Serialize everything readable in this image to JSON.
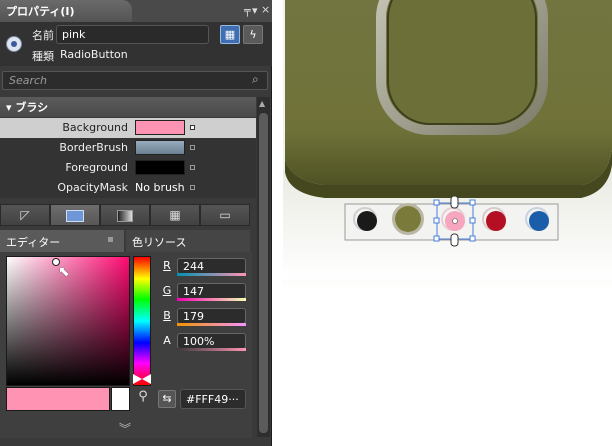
{
  "panel": {
    "title": "プロパティ(I)",
    "header_icons": [
      "pin-icon",
      "dropdown-icon",
      "close-icon"
    ],
    "name_label": "名前",
    "name_value": "pink",
    "type_label": "種類",
    "type_value": "RadioButton",
    "search_placeholder": "Search",
    "category": "ブラシ"
  },
  "brush_properties": [
    {
      "label": "Background",
      "color": "#ff93b3"
    },
    {
      "label": "BorderBrush",
      "color": "#7f96a8"
    },
    {
      "label": "Foreground",
      "color": "#000000"
    },
    {
      "label": "OpacityMask",
      "value": "No brush"
    }
  ],
  "brush_tools": [
    "no-brush-icon",
    "solid-brush-icon",
    "gradient-brush-icon",
    "tile-brush-icon",
    "resource-brush-icon"
  ],
  "color_tabs": {
    "editor": "エディター",
    "resources": "色リソース"
  },
  "color": {
    "channels": [
      {
        "label": "R",
        "value": "244"
      },
      {
        "label": "G",
        "value": "147"
      },
      {
        "label": "B",
        "value": "179"
      },
      {
        "label": "A",
        "value": "100%"
      }
    ],
    "hex": "#FFF49···",
    "current": "#ff93b3",
    "previous": "#ffffff"
  },
  "scene": {
    "radio_buttons": [
      {
        "name": "black",
        "color": "#1a1a1a"
      },
      {
        "name": "olive",
        "color": "#7a7a3a"
      },
      {
        "name": "pink",
        "color": "#f7a6bf"
      },
      {
        "name": "red",
        "color": "#b40f22"
      },
      {
        "name": "blue",
        "color": "#1a5eaa"
      }
    ]
  }
}
